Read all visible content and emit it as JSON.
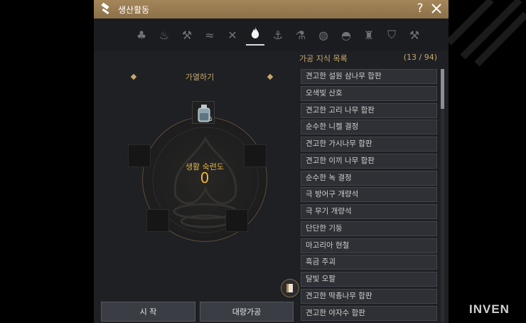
{
  "window": {
    "title": "생산활동",
    "help": "?"
  },
  "tabs": [
    {
      "icon": "gathering-icon"
    },
    {
      "icon": "alchemy-icon"
    },
    {
      "icon": "woodcutting-icon"
    },
    {
      "icon": "fishing-icon"
    },
    {
      "icon": "hunting-icon"
    },
    {
      "icon": "heating-icon",
      "active": true
    },
    {
      "icon": "anvil-icon"
    },
    {
      "icon": "flask-icon"
    },
    {
      "icon": "bbq-grill-icon"
    },
    {
      "icon": "cloche-icon"
    },
    {
      "icon": "chess-rook-icon"
    },
    {
      "icon": "shield-crest-icon"
    },
    {
      "icon": "hammer-icon"
    }
  ],
  "process": {
    "heading": "가열하기",
    "mastery_label": "생활 숙련도",
    "mastery_value": "0",
    "item_count": "5",
    "start_button": "시 작",
    "mass_button": "대량가공"
  },
  "knowledge": {
    "title": "가공 지식 목록",
    "count": "(13 / 94)",
    "items": [
      "견고한 설원 삼나무 합판",
      "오색빛 산호",
      "견고한 고리 나무 합판",
      "순수한 니켈 결정",
      "견고한 가시나무 합판",
      "견고한 이끼 나무 합판",
      "순수한 녹 결정",
      "극 방어구 개량석",
      "극 무기 개량석",
      "단단한 기둥",
      "마고리아 현철",
      "흑금 주괴",
      "달빛 오팔",
      "견고한 딱총나무 합판",
      "견고한 야자수 합판"
    ],
    "scroll_position": 0
  },
  "watermark": "INVEN"
}
